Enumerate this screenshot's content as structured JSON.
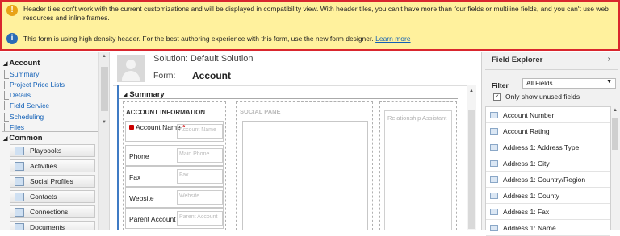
{
  "banner": {
    "warning_text": "Header tiles don't work with the current customizations and will be displayed in compatibility view. With header tiles, you can't have more than four fields or multiline fields, and you can't use web resources and inline frames.",
    "info_text": "This form is using high density header. For the best authoring experience with this form, use the new form designer.",
    "info_link": "Learn more"
  },
  "nav": {
    "account_heading": "Account",
    "account_links": [
      "Summary",
      "Project Price Lists",
      "Details",
      "Field Service",
      "Scheduling",
      "Files"
    ],
    "common_heading": "Common",
    "common_items": [
      "Playbooks",
      "Activities",
      "Social Profiles",
      "Contacts",
      "Connections",
      "Documents"
    ]
  },
  "header": {
    "solution": "Solution: Default Solution",
    "form_label": "Form:",
    "form_name": "Account"
  },
  "form": {
    "tab_title": "Summary",
    "section_title": "ACCOUNT INFORMATION",
    "social_title": "SOCIAL PANE",
    "relationship_label": "Relationship Assistant",
    "fields": [
      {
        "label": "Account Name",
        "placeholder": "Account Name",
        "required": "*"
      },
      {
        "label": "Phone",
        "placeholder": "Main Phone"
      },
      {
        "label": "Fax",
        "placeholder": "Fax"
      },
      {
        "label": "Website",
        "placeholder": "Website"
      },
      {
        "label": "Parent Account",
        "placeholder": "Parent Account"
      }
    ]
  },
  "explorer": {
    "title": "Field Explorer",
    "chevron": "›",
    "filter_label": "Filter",
    "filter_value": "All Fields",
    "only_unused": "Only show unused fields",
    "fields": [
      "Account Number",
      "Account Rating",
      "Address 1: Address Type",
      "Address 1: City",
      "Address 1: Country/Region",
      "Address 1: County",
      "Address 1: Fax",
      "Address 1: Name"
    ]
  }
}
